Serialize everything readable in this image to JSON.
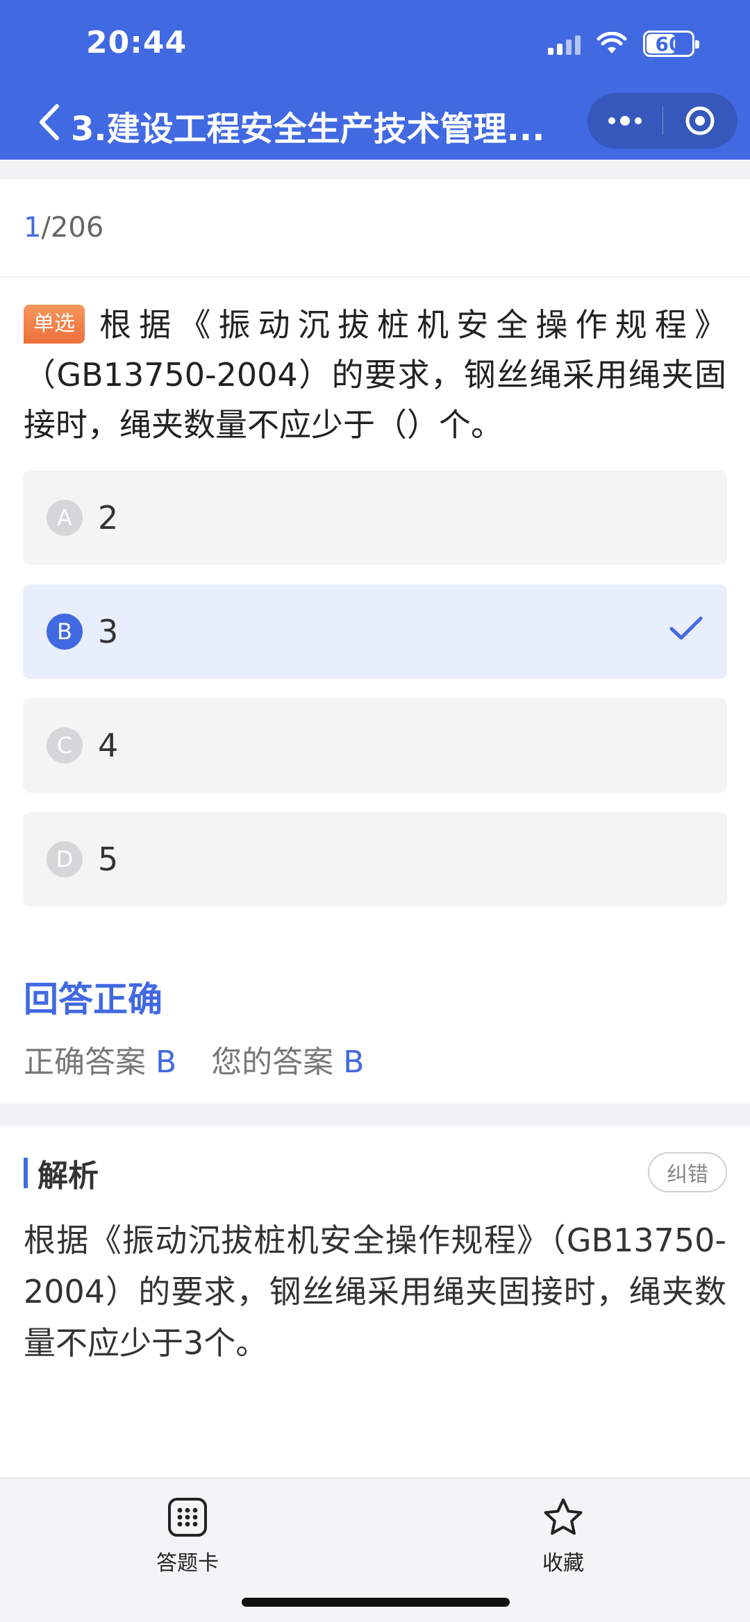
{
  "status_bar": {
    "time": "20:44",
    "battery": "60"
  },
  "nav": {
    "title": "3.建设工程安全生产技术管理...",
    "colors": {
      "primary": "#4169e1",
      "badge": "#ef6f3a"
    }
  },
  "counter": {
    "current": "1",
    "total": "/206"
  },
  "question": {
    "type_badge": "单选",
    "text": "根据《振动沉拔桩机安全操作规程》（GB13750-2004）的要求，钢丝绳采用绳夹固接时，绳夹数量不应少于（）个。",
    "options": [
      {
        "letter": "A",
        "text": "2"
      },
      {
        "letter": "B",
        "text": "3"
      },
      {
        "letter": "C",
        "text": "4"
      },
      {
        "letter": "D",
        "text": "5"
      }
    ],
    "selected": "B"
  },
  "result": {
    "title": "回答正确",
    "correct_label": "正确答案",
    "correct_value": "B",
    "your_label": "您的答案",
    "your_value": "B"
  },
  "analysis": {
    "title": "解析",
    "report_label": "纠错",
    "text": "根据《振动沉拔桩机安全操作规程》（GB13750-2004）的要求，钢丝绳采用绳夹固接时，绳夹数量不应少于3个。"
  },
  "tabbar": {
    "card_label": "答题卡",
    "favorite_label": "收藏"
  }
}
